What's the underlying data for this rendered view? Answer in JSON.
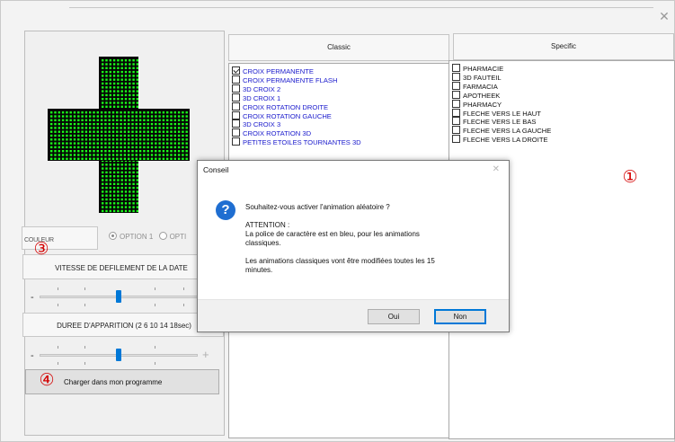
{
  "window": {
    "close_glyph": "✕"
  },
  "preview": {
    "cross_color": "#1aff1a"
  },
  "options": {
    "couleur_label": "COULEUR",
    "option1_label": "OPTION 1",
    "option2_label": "OPTI"
  },
  "vitesse": {
    "label": "VITESSE DE DEFILEMENT DE LA DATE",
    "minus": "-",
    "value_ticks": 5
  },
  "duree": {
    "label": "DUREE D'APPARITION (2 6 10 14 18sec)",
    "minus": "-",
    "plus": "+"
  },
  "charger_button": {
    "label": "Charger dans mon programme"
  },
  "annotations": {
    "marker_1": "①",
    "marker_3": "③",
    "marker_4": "④"
  },
  "classic": {
    "header": "Classic",
    "items": [
      {
        "label": "CROIX PERMANENTE",
        "checked": true
      },
      {
        "label": "CROIX PERMANENTE FLASH",
        "checked": false
      },
      {
        "label": "3D CROIX 2",
        "checked": false
      },
      {
        "label": "3D CROIX 1",
        "checked": false
      },
      {
        "label": "CROIX ROTATION DROITE",
        "checked": false
      },
      {
        "label": "CROIX ROTATION GAUCHE",
        "checked": false
      },
      {
        "label": "3D CROIX 3",
        "checked": false
      },
      {
        "label": "CROIX ROTATION 3D",
        "checked": false
      },
      {
        "label": "PETITES ETOILES TOURNANTES 3D",
        "checked": false
      }
    ]
  },
  "specific": {
    "header": "Specific",
    "items": [
      {
        "label": "PHARMACIE",
        "checked": false
      },
      {
        "label": "3D FAUTEIL",
        "checked": false
      },
      {
        "label": "FARMACIA",
        "checked": false
      },
      {
        "label": "APOTHEEK",
        "checked": false
      },
      {
        "label": "PHARMACY",
        "checked": false
      },
      {
        "label": "FLECHE VERS LE HAUT",
        "checked": false
      },
      {
        "label": "FLECHE VERS LE BAS",
        "checked": false
      },
      {
        "label": "FLECHE VERS LA GAUCHE",
        "checked": false
      },
      {
        "label": "FLECHE VERS LA DROITE",
        "checked": false
      }
    ]
  },
  "dialog": {
    "title": "Conseil",
    "close_glyph": "✕",
    "icon_glyph": "?",
    "question": "Souhaitez-vous activer l'animation aléatoire ?",
    "attention": "ATTENTION :",
    "line2a": "La police de caractère est en bleu, pour les animations",
    "line2b": "classiques.",
    "line3a": "Les animations classiques vont être modifiées toutes les 15",
    "line3b": "minutes.",
    "oui": "Oui",
    "non": "Non"
  }
}
